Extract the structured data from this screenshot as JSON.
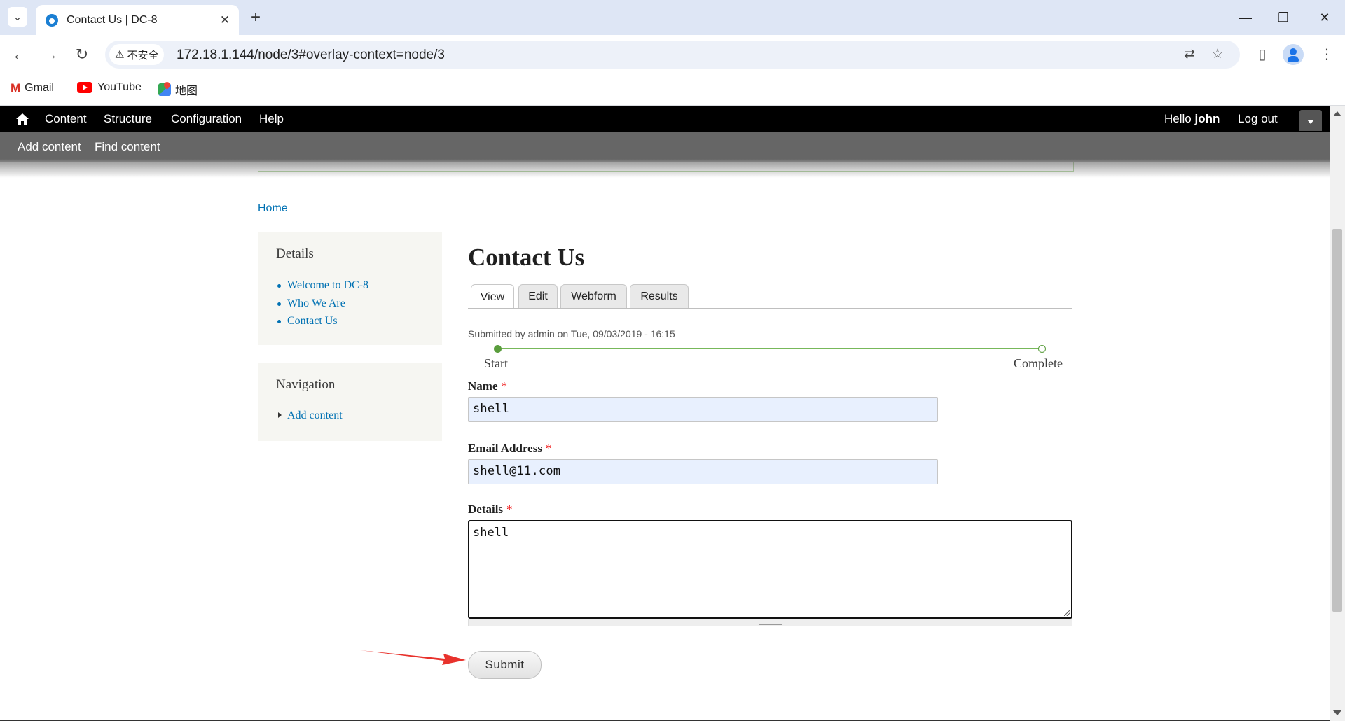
{
  "browser": {
    "tab_title": "Contact Us | DC-8",
    "security_label": "不安全",
    "url": "172.18.1.144/node/3#overlay-context=node/3",
    "bookmarks": [
      {
        "label": "Gmail",
        "icon": "gmail-icon"
      },
      {
        "label": "YouTube",
        "icon": "youtube-icon"
      },
      {
        "label": "地图",
        "icon": "maps-icon"
      }
    ]
  },
  "admin_toolbar": {
    "items": [
      "Content",
      "Structure",
      "Configuration",
      "Help"
    ],
    "greeting": "Hello ",
    "username": "john",
    "logout": "Log out"
  },
  "shortcuts": [
    "Add content",
    "Find content"
  ],
  "breadcrumb": {
    "home": "Home"
  },
  "sidebar": {
    "details": {
      "title": "Details",
      "links": [
        "Welcome to DC-8",
        "Who We Are",
        "Contact Us"
      ]
    },
    "navigation": {
      "title": "Navigation",
      "links": [
        "Add content"
      ]
    }
  },
  "main": {
    "title": "Contact Us",
    "tabs": [
      "View",
      "Edit",
      "Webform",
      "Results"
    ],
    "active_tab": "View",
    "submitted": "Submitted by admin on Tue, 09/03/2019 - 16:15",
    "progress": {
      "start_label": "Start",
      "end_label": "Complete"
    },
    "form": {
      "name_label": "Name",
      "name_value": "shell",
      "email_label": "Email Address",
      "email_value": "shell@11.com",
      "details_label": "Details",
      "details_value": "shell",
      "required_marker": "*",
      "submit_label": "Submit"
    }
  },
  "colors": {
    "link": "#0071b3",
    "admin_bar": "#000000",
    "shortcut_bar": "#666666",
    "progress": "#77b85a",
    "annotation_arrow": "#e8322c"
  }
}
